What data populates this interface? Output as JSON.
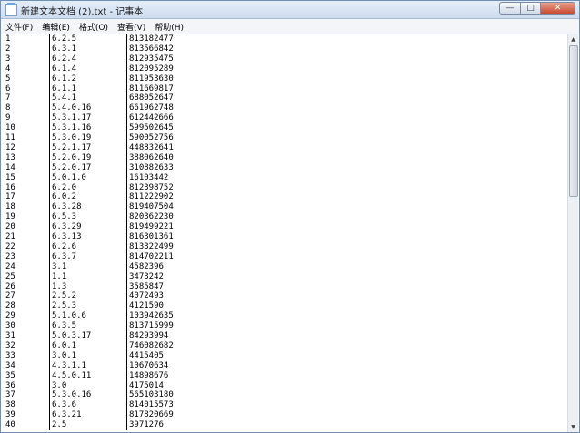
{
  "window": {
    "title": "新建文本文档 (2).txt - 记事本",
    "controls": {
      "minimize": "—",
      "maximize": "□",
      "close": "✕"
    }
  },
  "menu": [
    {
      "label": "文件(F)"
    },
    {
      "label": "编辑(E)"
    },
    {
      "label": "格式(O)"
    },
    {
      "label": "查看(V)"
    },
    {
      "label": "帮助(H)"
    }
  ],
  "rows": [
    [
      "1",
      "6.2.5",
      "813182477"
    ],
    [
      "2",
      "6.3.1",
      "813566842"
    ],
    [
      "3",
      "6.2.4",
      "812935475"
    ],
    [
      "4",
      "6.1.4",
      "812095289"
    ],
    [
      "5",
      "6.1.2",
      "811953630"
    ],
    [
      "6",
      "6.1.1",
      "811669817"
    ],
    [
      "7",
      "5.4.1",
      "688052647"
    ],
    [
      "8",
      "5.4.0.16",
      "661962748"
    ],
    [
      "9",
      "5.3.1.17",
      "612442666"
    ],
    [
      "10",
      "5.3.1.16",
      "599502645"
    ],
    [
      "11",
      "5.3.0.19",
      "590052756"
    ],
    [
      "12",
      "5.2.1.17",
      "448832641"
    ],
    [
      "13",
      "5.2.0.19",
      "388062640"
    ],
    [
      "14",
      "5.2.0.17",
      "310882633"
    ],
    [
      "15",
      "5.0.1.0",
      "16103442"
    ],
    [
      "16",
      "6.2.0",
      "812398752"
    ],
    [
      "17",
      "6.0.2",
      "811222902"
    ],
    [
      "18",
      "6.3.28",
      "819407504"
    ],
    [
      "19",
      "6.5.3",
      "820362230"
    ],
    [
      "20",
      "6.3.29",
      "819499221"
    ],
    [
      "21",
      "6.3.13",
      "816301361"
    ],
    [
      "22",
      "6.2.6",
      "813322499"
    ],
    [
      "23",
      "6.3.7",
      "814702211"
    ],
    [
      "24",
      "3.1",
      "4582396"
    ],
    [
      "25",
      "1.1",
      "3473242"
    ],
    [
      "26",
      "1.3",
      "3585847"
    ],
    [
      "27",
      "2.5.2",
      "4072493"
    ],
    [
      "28",
      "2.5.3",
      "4121590"
    ],
    [
      "29",
      "5.1.0.6",
      "103942635"
    ],
    [
      "30",
      "6.3.5",
      "813715999"
    ],
    [
      "31",
      "5.0.3.17",
      "84293994"
    ],
    [
      "32",
      "6.0.1",
      "746082682"
    ],
    [
      "33",
      "3.0.1",
      "4415405"
    ],
    [
      "34",
      "4.3.1.1",
      "10670634"
    ],
    [
      "35",
      "4.5.0.11",
      "14898676"
    ],
    [
      "36",
      "3.0",
      "4175014"
    ],
    [
      "37",
      "5.3.0.16",
      "565103180"
    ],
    [
      "38",
      "6.3.6",
      "814015573"
    ],
    [
      "39",
      "6.3.21",
      "817820669"
    ],
    [
      "40",
      "2.5",
      "3971276"
    ]
  ],
  "scrollbar": {
    "up_arrow": "▲",
    "down_arrow": "▼"
  }
}
